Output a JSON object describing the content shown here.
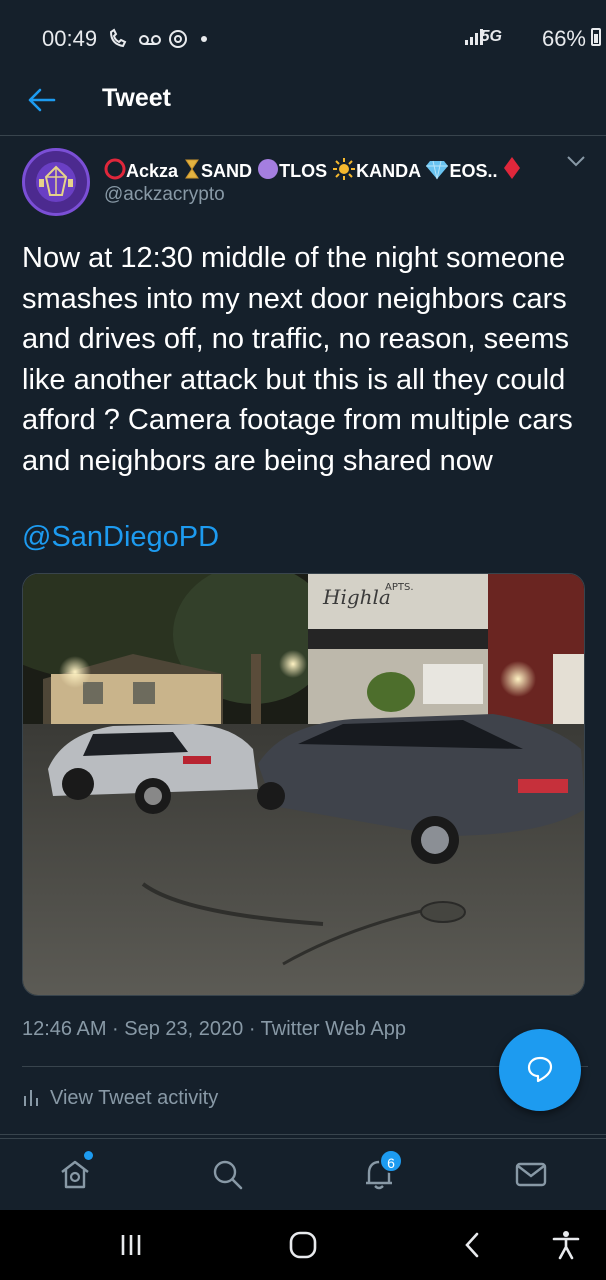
{
  "status_bar": {
    "time": "00:49",
    "left_icons": [
      "call-icon",
      "voicemail-icon",
      "chrome-icon",
      "dot-icon"
    ],
    "network": "5G",
    "battery": "66%"
  },
  "header": {
    "title": "Tweet",
    "back_icon": "back-arrow-icon"
  },
  "tweet": {
    "author": {
      "name_parts": [
        "Ackza",
        "SAND",
        "TLOS",
        "KANDA",
        "EOS.."
      ],
      "handle": "@ackzacrypto"
    },
    "text": "Now at 12:30 middle of the night someone smashes into my next door neighbors cars and drives off, no traffic, no reason, seems like another attack but this is all they could afford ? Camera footage from multiple cars and neighbors are being shared now",
    "mention": "@SanDiegoPD",
    "photo": {
      "sign_text": "Highland APTS.",
      "sign_script": "Highla",
      "sign_caps": "APTS."
    },
    "timestamp": "12:46 AM · Sep 23, 2020 · Twitter Web App",
    "activity_label": "View Tweet activity"
  },
  "bottom_nav": {
    "items": [
      "home-icon",
      "search-icon",
      "notifications-icon",
      "messages-icon"
    ],
    "notification_count": "6"
  },
  "colors": {
    "background": "#15202b",
    "accent": "#1d9bf0",
    "secondary_text": "#8899a6",
    "divider": "#38444d"
  }
}
